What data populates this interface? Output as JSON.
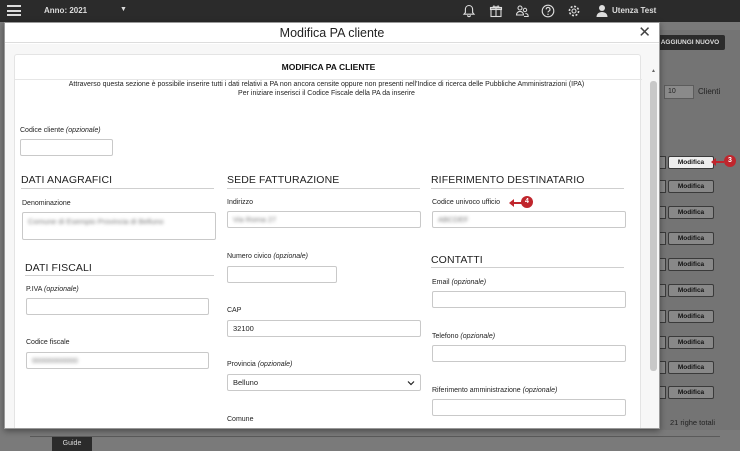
{
  "topbar": {
    "year_label": "Anno: 2021",
    "user_name": "Utenza Test",
    "icons": [
      "bell-icon",
      "gift-icon",
      "users-icon",
      "help-icon",
      "gear-icon",
      "user-icon"
    ]
  },
  "background": {
    "add_new_label": "AGGIUNGI NUOVO",
    "rows_per_page": "10",
    "rows_label": "Clienti",
    "row_button_label": "Modifica",
    "total_label": "21 righe totali",
    "guide_tab": "Guide"
  },
  "callouts": {
    "first": "3",
    "second": "4"
  },
  "modal": {
    "title": "Modifica PA cliente",
    "card_title": "MODIFICA PA CLIENTE",
    "intro_line1": "Attraverso questa sezione è possibile inserire tutti i dati relativi a PA non ancora censite oppure non presenti nell'Indice di ricerca delle Pubbliche Amministrazioni (IPA)",
    "intro_line2": "Per iniziare inserisci il Codice Fiscale della PA da inserire",
    "optional": "(opzionale)",
    "codice_cliente": {
      "label": "Codice cliente",
      "value": ""
    },
    "dati_anagrafici": {
      "heading": "DATI ANAGRAFICI",
      "denominazione_label": "Denominazione",
      "denominazione_value": "Comune di Esempio Provincia di Belluno"
    },
    "dati_fiscali": {
      "heading": "DATI FISCALI",
      "piva_label": "P.IVA",
      "piva_value": "",
      "cf_label": "Codice fiscale",
      "cf_value": "00000000000"
    },
    "sede": {
      "heading": "SEDE FATTURAZIONE",
      "indirizzo_label": "Indirizzo",
      "indirizzo_value": "Via Roma 27",
      "civico_label": "Numero civico",
      "civico_value": "",
      "cap_label": "CAP",
      "cap_value": "32100",
      "provincia_label": "Provincia",
      "provincia_value": "Belluno",
      "comune_label": "Comune"
    },
    "riferimento": {
      "heading": "RIFERIMENTO DESTINATARIO",
      "cuu_label": "Codice univoco ufficio",
      "cuu_value": "ABCDEF"
    },
    "contatti": {
      "heading": "CONTATTI",
      "email_label": "Email",
      "email_value": "",
      "telefono_label": "Telefono",
      "telefono_value": "",
      "rif_amm_label": "Riferimento amministrazione",
      "rif_amm_value": ""
    }
  }
}
